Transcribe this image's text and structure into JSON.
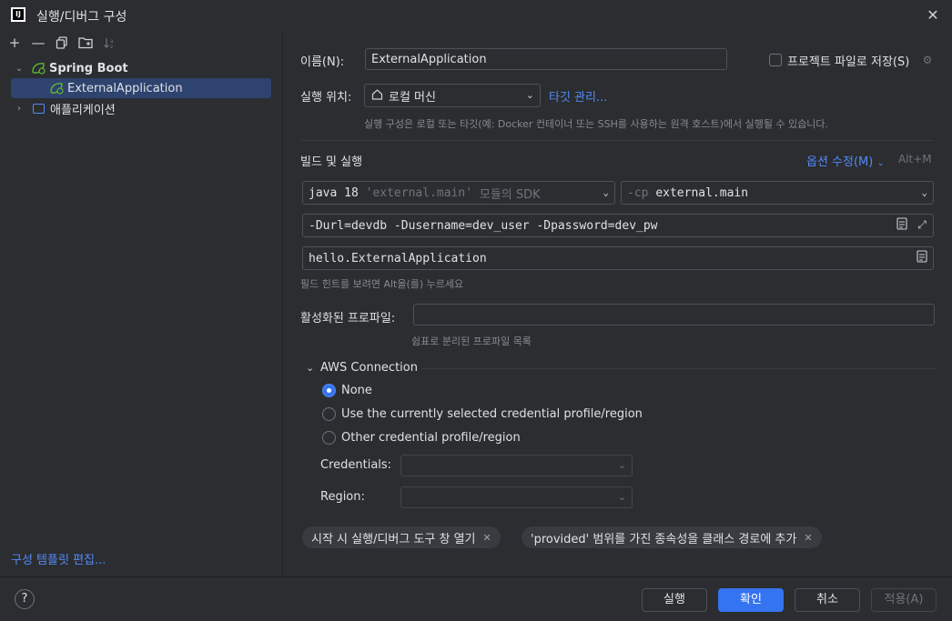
{
  "window": {
    "title": "실행/디버그 구성",
    "logo_text": "IJ",
    "close_icon": "close-icon"
  },
  "toolbar": {
    "add": "+",
    "remove": "—",
    "copy": "⧉",
    "folder": "▭",
    "sort": "↓²"
  },
  "tree": {
    "group_label": "Spring Boot",
    "child_label": "ExternalApplication",
    "app_label": "애플리케이션"
  },
  "left_footer": {
    "template_link": "구성 템플릿 편집..."
  },
  "form": {
    "name_label": "이름(N):",
    "name_value": "ExternalApplication",
    "store_as_file_label": "프로젝트 파일로 저장(S)",
    "run_on_label": "실행 위치:",
    "run_on_value": "로컬 머신",
    "manage_targets": "타깃 관리...",
    "run_on_hint": "실행 구성은 로컬 또는 타깃(예: Docker 컨테이너 또는 SSH를 사용하는 원격 호스트)에서 실행될 수 있습니다.",
    "build_run_title": "빌드 및 실행",
    "modify_options": "옵션 수정(M)",
    "modify_shortcut": "Alt+M",
    "jdk_prefix": "java 18",
    "jdk_module": "'external.main'",
    "jdk_suffix": "모듈의 SDK",
    "cp_prefix": "-cp",
    "cp_value": "external.main",
    "vm_options": "-Durl=devdb -Dusername=dev_user -Dpassword=dev_pw",
    "main_class": "hello.ExternalApplication",
    "field_hint": "필드 힌트를 보려면 Alt을(를) 누르세요",
    "profiles_label": "활성화된 프로파일:",
    "profiles_value": "",
    "profiles_hint": "쉼표로 분리된 프로파일 목록"
  },
  "aws": {
    "section_title": "AWS Connection",
    "options": [
      "None",
      "Use the currently selected credential profile/region",
      "Other credential profile/region"
    ],
    "credentials_label": "Credentials:",
    "region_label": "Region:"
  },
  "chips": [
    "시작 시 실행/디버그 도구 창 열기",
    "'provided' 범위를 가진 종속성을 클래스 경로에 추가"
  ],
  "buttons": {
    "help": "?",
    "run": "실행",
    "ok": "확인",
    "cancel": "취소",
    "apply": "적용(A)"
  }
}
